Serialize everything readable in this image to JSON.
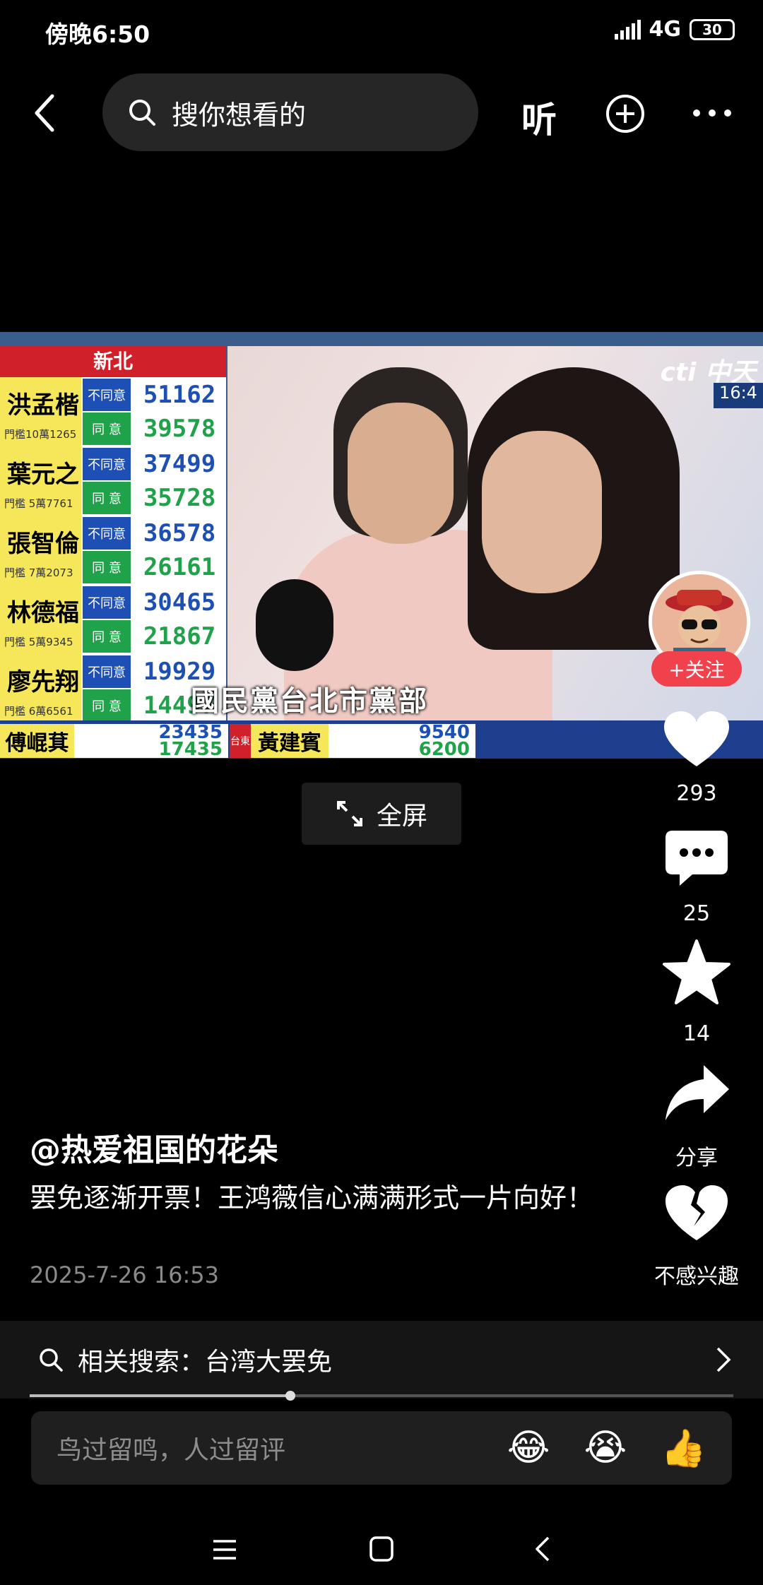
{
  "status_bar": {
    "time": "傍晚6:50",
    "network": "4G",
    "battery": "30"
  },
  "top_nav": {
    "search_placeholder": "搜你想看的",
    "listen_label": "听"
  },
  "video": {
    "scoreboard_title": "新北",
    "rows": [
      {
        "name": "洪孟楷",
        "sub": "門檻10萬1265",
        "no_label": "不同意",
        "yes_label": "同 意",
        "no": "51162",
        "yes": "39578"
      },
      {
        "name": "葉元之",
        "sub": "門檻 5萬7761",
        "no_label": "不同意",
        "yes_label": "同 意",
        "no": "37499",
        "yes": "35728"
      },
      {
        "name": "張智倫",
        "sub": "門檻 7萬2073",
        "no_label": "不同意",
        "yes_label": "同 意",
        "no": "36578",
        "yes": "26161"
      },
      {
        "name": "林德福",
        "sub": "門檻 5萬9345",
        "no_label": "不同意",
        "yes_label": "同 意",
        "no": "30465",
        "yes": "21867"
      },
      {
        "name": "廖先翔",
        "sub": "門檻 6萬6561",
        "no_label": "不同意",
        "yes_label": "同 意",
        "no": "19929",
        "yes": "14497"
      }
    ],
    "bottom_left": {
      "name": "傅崐萁",
      "no": "23435",
      "yes": "17435"
    },
    "bottom_right": {
      "region": "台東",
      "name": "黃建賓",
      "no": "9540",
      "yes": "6200"
    },
    "channel": "cti 中天",
    "clock": "16:4",
    "caption": "國民黨台北市黨部"
  },
  "fullscreen_label": "全屏",
  "right_rail": {
    "follow_label": "+关注",
    "likes": "293",
    "comments": "25",
    "favorites": "14",
    "share_label": "分享",
    "not_interested_label": "不感兴趣"
  },
  "post": {
    "author": "@热爱祖国的花朵",
    "description": "罢免逐渐开票！王鸿薇信心满满形式一片向好！",
    "date": "2025-7-26 16:53"
  },
  "related_search": "相关搜索：台湾大罢免",
  "playback_progress": 0.37,
  "comment": {
    "placeholder": "鸟过留鸣，人过留评",
    "emojis": [
      "😂",
      "😭",
      "👍"
    ]
  }
}
